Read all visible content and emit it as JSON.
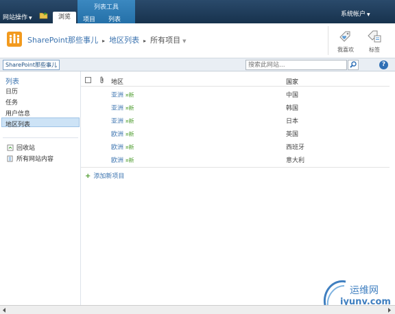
{
  "ribbon": {
    "site_actions_label": "网站操作",
    "tab_browse": "浏览",
    "list_tools_title": "列表工具",
    "tab_items": "项目",
    "tab_list": "列表",
    "account_label": "系统帐户"
  },
  "title_area": {
    "site_name": "SharePoint那些事儿",
    "list_name": "地区列表",
    "view_name": "所有项目",
    "like_label": "我喜欢",
    "tags_label": "标签"
  },
  "nav_row": {
    "home_tab": "SharePoint那些事儿",
    "search_placeholder": "搜索此网站..."
  },
  "left_nav": {
    "heading": "列表",
    "items": [
      "日历",
      "任务",
      "用户信息",
      "地区列表"
    ],
    "selected": "地区列表",
    "recycle_bin": "回收站",
    "all_site_content": "所有网站内容"
  },
  "list": {
    "col_region": "地区",
    "col_country": "国家",
    "new_badge": "新",
    "rows": [
      {
        "region": "亚洲",
        "country": "中国"
      },
      {
        "region": "亚洲",
        "country": "韩国"
      },
      {
        "region": "亚洲",
        "country": "日本"
      },
      {
        "region": "欧洲",
        "country": "英国"
      },
      {
        "region": "欧洲",
        "country": "西班牙"
      },
      {
        "region": "欧洲",
        "country": "意大利"
      }
    ],
    "add_item_label": "添加新项目"
  },
  "watermark": {
    "name": "运维网",
    "url": "iyunv.com"
  },
  "colors": {
    "ribbon_dark": "#1f3a57",
    "list_tools_blue": "#2f7fbb",
    "link_blue": "#3b73af",
    "new_green": "#4a9a2a",
    "logo_orange": "#f29a1e"
  }
}
